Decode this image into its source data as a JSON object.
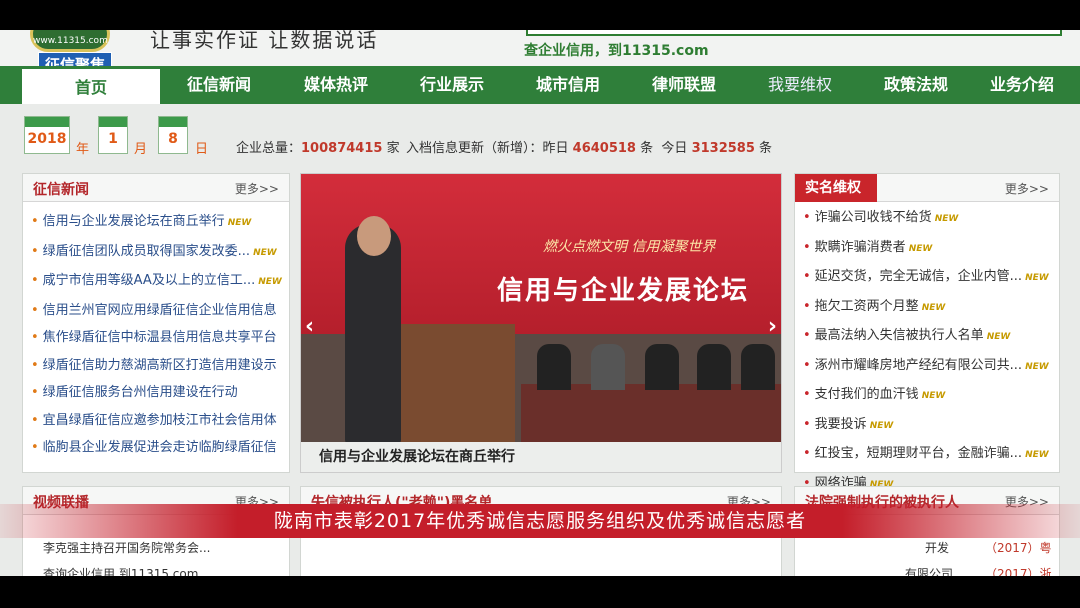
{
  "header": {
    "logo_text": "www.11315.com",
    "slogan": "让事实作证 让数据说话",
    "query_text": "查企业信用，到11315.com",
    "badge": "征信聚焦"
  },
  "nav": [
    "首页",
    "征信新闻",
    "媒体热评",
    "行业展示",
    "城市信用",
    "律师联盟",
    "我要维权",
    "政策法规",
    "业务介绍"
  ],
  "date": {
    "year": "2018",
    "year_unit": "年",
    "month": "1",
    "month_unit": "月",
    "day": "8",
    "day_unit": "日"
  },
  "stats": {
    "total_label": "企业总量：",
    "total_value": "100874415",
    "total_unit": "家",
    "update_label": "入档信息更新（新增）：昨日",
    "yesterday": "4640518",
    "unit1": "条",
    "today_label": "今日",
    "today": "3132585",
    "unit2": "条"
  },
  "news": {
    "title": "征信新闻",
    "more": "更多>>",
    "items": [
      {
        "text": "信用与企业发展论坛在商丘举行",
        "new": "NEW"
      },
      {
        "text": "绿盾征信团队成员取得国家发改委...",
        "new": "NEW"
      },
      {
        "text": "咸宁市信用等级AA及以上的立信工...",
        "new": "NEW"
      },
      {
        "text": "信用兰州官网应用绿盾征信企业信用信息",
        "new": ""
      },
      {
        "text": "焦作绿盾征信中标温县信用信息共享平台",
        "new": ""
      },
      {
        "text": "绿盾征信助力慈湖高新区打造信用建设示",
        "new": ""
      },
      {
        "text": "绿盾征信服务台州信用建设在行动",
        "new": ""
      },
      {
        "text": "宜昌绿盾征信应邀参加枝江市社会信用体",
        "new": ""
      },
      {
        "text": "临朐县企业发展促进会走访临朐绿盾征信",
        "new": ""
      }
    ]
  },
  "slide": {
    "banner_sub": "燃火点燃文明 信用凝聚世界",
    "banner_title": "信用与企业发展论坛",
    "caption": "信用与企业发展论坛在商丘举行",
    "prev": "‹",
    "next": "›"
  },
  "rights": {
    "title": "实名维权",
    "more": "更多>>",
    "items": [
      {
        "text": "诈骗公司收钱不给货",
        "new": "NEW"
      },
      {
        "text": "欺瞒诈骗消费者",
        "new": "NEW"
      },
      {
        "text": "延迟交货，完全无诚信，企业内管...",
        "new": "NEW"
      },
      {
        "text": "拖欠工资两个月整",
        "new": "NEW"
      },
      {
        "text": "最高法纳入失信被执行人名单",
        "new": "NEW"
      },
      {
        "text": "涿州市耀峰房地产经纪有限公司共...",
        "new": "NEW"
      },
      {
        "text": "支付我们的血汗钱",
        "new": "NEW"
      },
      {
        "text": "我要投诉",
        "new": "NEW"
      },
      {
        "text": "红投宝，短期理财平台，金融诈骗...",
        "new": "NEW"
      },
      {
        "text": "网络诈骗",
        "new": "NEW"
      }
    ]
  },
  "bottom": {
    "video_title": "视频联播",
    "video_more": "更多>>",
    "mid_title": "失信被执行人(\"老赖\")黑名单",
    "mid_more": "更多>>",
    "right_title": "法院强制执行的被执行人",
    "right_more": "更多>>",
    "v1": "李克强主持召开国务院常务会...",
    "v2": "查询企业信用 到11315.com",
    "r1": "开发",
    "r1y": "（2017）粤",
    "r2": "有限公司",
    "r2y": "（2017）浙"
  },
  "subtitle": "陇南市表彰2017年优秀诚信志愿服务组织及优秀诚信志愿者"
}
